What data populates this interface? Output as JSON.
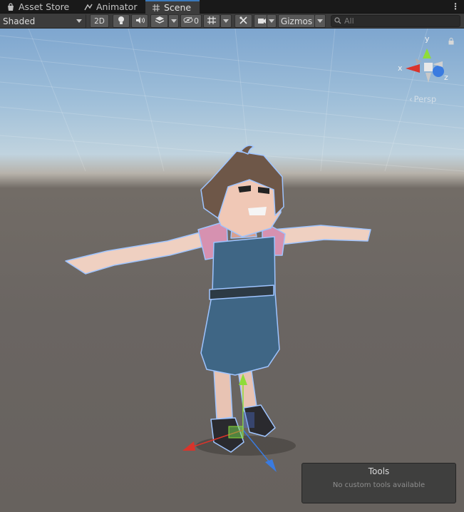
{
  "tabs": [
    {
      "label": "Asset Store",
      "icon": "shopping-bag-icon",
      "active": false
    },
    {
      "label": "Animator",
      "icon": "animator-icon",
      "active": false
    },
    {
      "label": "Scene",
      "icon": "scene-grid-icon",
      "active": true
    }
  ],
  "toolbar": {
    "shading_mode": "Shaded",
    "mode_2d": "2D",
    "hidden_count": "0",
    "gizmos_label": "Gizmos",
    "search_placeholder": "All"
  },
  "orientation_gizmo": {
    "y_label": "y",
    "x_label": "x",
    "z_label": "z",
    "projection": "Persp"
  },
  "tools_overlay": {
    "title": "Tools",
    "message": "No custom tools available"
  },
  "colors": {
    "accent_tab": "#3a79bb",
    "axis_x": "#d9342b",
    "axis_y": "#8fdc3a",
    "axis_z": "#3a7be0"
  }
}
